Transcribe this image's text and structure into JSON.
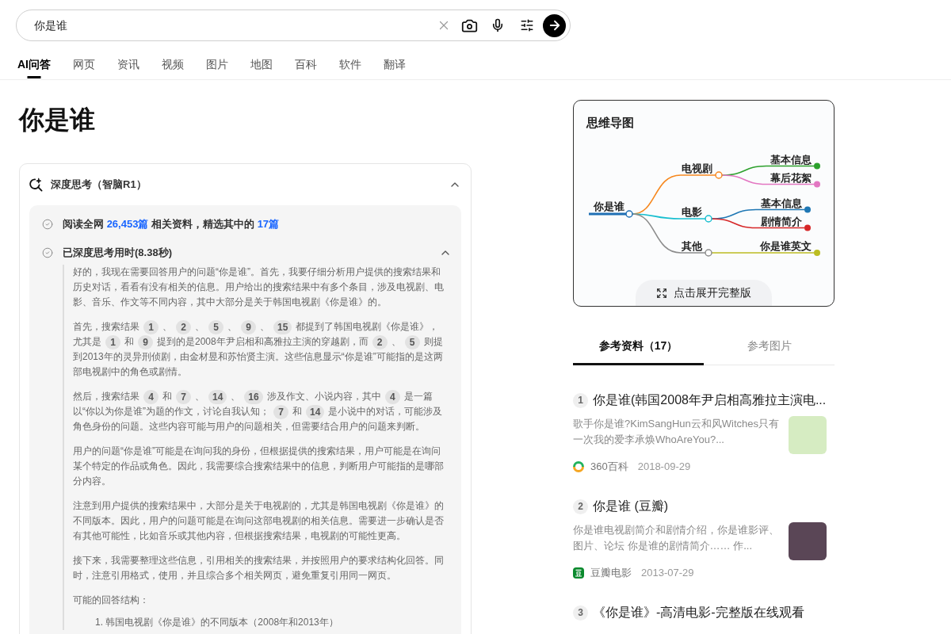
{
  "search": {
    "value": "你是谁"
  },
  "tabs": [
    {
      "label": "AI问答",
      "selected": true
    },
    {
      "label": "网页",
      "selected": false
    },
    {
      "label": "资讯",
      "selected": false
    },
    {
      "label": "视频",
      "selected": false
    },
    {
      "label": "图片",
      "selected": false
    },
    {
      "label": "地图",
      "selected": false
    },
    {
      "label": "百科",
      "selected": false
    },
    {
      "label": "软件",
      "selected": false
    },
    {
      "label": "翻译",
      "selected": false
    }
  ],
  "question": "你是谁",
  "thinking": {
    "title": "深度思考（智脑R1）",
    "expanded": true,
    "summary": [
      {
        "text": "阅读全网 ",
        "highlight": false
      },
      {
        "text": "26,453篇",
        "highlight": true
      },
      {
        "text": " 相关资料，精选其中的 ",
        "highlight": false
      },
      {
        "text": "17篇",
        "highlight": true
      }
    ],
    "duration": {
      "label": "已深度思考用时(8.38秒)",
      "expanded": true
    },
    "paragraphs": [
      {
        "segments": [
          {
            "kind": "text",
            "text": "好的，我现在需要回答用户的问题“你是谁”。首先，我要仔细分析用户提供的搜索结果和历史对话，看看有没有相关的信息。用户给出的搜索结果中有多个条目，涉及电视剧、电影、音乐、作文等不同内容，其中大部分是关于韩国电视剧《你是谁》的。"
          }
        ]
      },
      {
        "segments": [
          {
            "kind": "text",
            "text": "首先，搜索结果"
          },
          {
            "kind": "cite",
            "text": "1"
          },
          {
            "kind": "text",
            "text": "、"
          },
          {
            "kind": "cite",
            "text": "2"
          },
          {
            "kind": "text",
            "text": "、"
          },
          {
            "kind": "cite",
            "text": "5"
          },
          {
            "kind": "text",
            "text": "、"
          },
          {
            "kind": "cite",
            "text": "9"
          },
          {
            "kind": "text",
            "text": "、"
          },
          {
            "kind": "cite",
            "text": "15"
          },
          {
            "kind": "text",
            "text": "都提到了韩国电视剧《你是谁》，尤其是"
          },
          {
            "kind": "cite",
            "text": "1"
          },
          {
            "kind": "text",
            "text": "和"
          },
          {
            "kind": "cite",
            "text": "9"
          },
          {
            "kind": "text",
            "text": "提到的是2008年尹启相和高雅拉主演的穿越剧，而"
          },
          {
            "kind": "cite",
            "text": "2"
          },
          {
            "kind": "text",
            "text": "、"
          },
          {
            "kind": "cite",
            "text": "5"
          },
          {
            "kind": "text",
            "text": "则提到2013年的灵异刑侦剧，由金材昱和苏怡贤主演。这些信息显示“你是谁”可能指的是这两部电视剧中的角色或剧情。"
          }
        ]
      },
      {
        "segments": [
          {
            "kind": "text",
            "text": "然后，搜索结果"
          },
          {
            "kind": "cite",
            "text": "4"
          },
          {
            "kind": "text",
            "text": "和"
          },
          {
            "kind": "cite",
            "text": "7"
          },
          {
            "kind": "text",
            "text": "、"
          },
          {
            "kind": "cite",
            "text": "14"
          },
          {
            "kind": "text",
            "text": "、"
          },
          {
            "kind": "cite",
            "text": "16"
          },
          {
            "kind": "text",
            "text": "涉及作文、小说内容，其中"
          },
          {
            "kind": "cite",
            "text": "4"
          },
          {
            "kind": "text",
            "text": "是一篇以“你以为你是谁”为题的作文，讨论自我认知；"
          },
          {
            "kind": "cite",
            "text": "7"
          },
          {
            "kind": "text",
            "text": "和"
          },
          {
            "kind": "cite",
            "text": "14"
          },
          {
            "kind": "text",
            "text": "是小说中的对话，可能涉及角色身份的问题。这些内容可能与用户的问题相关，但需要结合用户的问题来判断。"
          }
        ]
      },
      {
        "segments": [
          {
            "kind": "text",
            "text": "用户的问题“你是谁”可能是在询问我的身份，但根据提供的搜索结果，用户可能是在询问某个特定的作品或角色。因此，我需要综合搜索结果中的信息，判断用户可能指的是哪部分内容。"
          }
        ]
      },
      {
        "segments": [
          {
            "kind": "text",
            "text": "注意到用户提供的搜索结果中，大部分是关于电视剧的，尤其是韩国电视剧《你是谁》的不同版本。因此，用户的问题可能是在询问这部电视剧的相关信息。需要进一步确认是否有其他可能性，比如音乐或其他内容，但根据搜索结果，电视剧的可能性更高。"
          }
        ]
      },
      {
        "segments": [
          {
            "kind": "text",
            "text": "接下来，我需要整理这些信息，引用相关的搜索结果，并按照用户的要求结构化回答。同时，注意引用格式，使用，并且综合多个相关网页，避免重复引用同一网页。"
          }
        ]
      },
      {
        "segments": [
          {
            "kind": "text",
            "text": "可能的回答结构："
          }
        ]
      }
    ],
    "list": [
      {
        "marker": "1.",
        "text": "韩国电视剧《你是谁》的不同版本（2008年和2013年）"
      }
    ]
  },
  "mind_map": {
    "title": "思维导图",
    "root": {
      "label": "你是谁",
      "children": [
        {
          "label": "电视剧",
          "color": "#f7881f",
          "children": [
            {
              "label": "基本信息",
              "color": "#2ca02c"
            },
            {
              "label": "幕后花絮",
              "color": "#e377c2"
            }
          ]
        },
        {
          "label": "电影",
          "color": "#17becf",
          "children": [
            {
              "label": "基本信息",
              "color": "#1f77b4"
            },
            {
              "label": "剧情简介",
              "color": "#d62728"
            }
          ]
        },
        {
          "label": "其他",
          "color": "#8c8c8c",
          "children": [
            {
              "label": "你是谁英文",
              "color": "#bcbd22"
            }
          ]
        }
      ]
    },
    "expand_button": "点击展开完整版"
  },
  "references": {
    "tabs": [
      {
        "label": "参考资料（17）",
        "selected": true
      },
      {
        "label": "参考图片",
        "selected": false
      }
    ],
    "items": [
      {
        "index": "1",
        "title": "你是谁(韩国2008年尹启相高雅拉主演电...",
        "snippet": "歌手你是谁?KimSangHun云和风Witches只有一次我的爱李承焕WhoAreYou?...",
        "source": {
          "kind": "baike360",
          "name": "360百科"
        },
        "date": "2018-09-29"
      },
      {
        "index": "2",
        "title": "你是谁 (豆瓣)",
        "snippet": "你是谁电视剧简介和剧情介绍，你是谁影评、图片、论坛 你是谁的剧情简介…… 作...",
        "source": {
          "kind": "douban",
          "name": "豆瓣电影"
        },
        "date": "2013-07-29"
      },
      {
        "index": "3",
        "title": "《你是谁》-高清电影-完整版在线观看"
      }
    ]
  }
}
